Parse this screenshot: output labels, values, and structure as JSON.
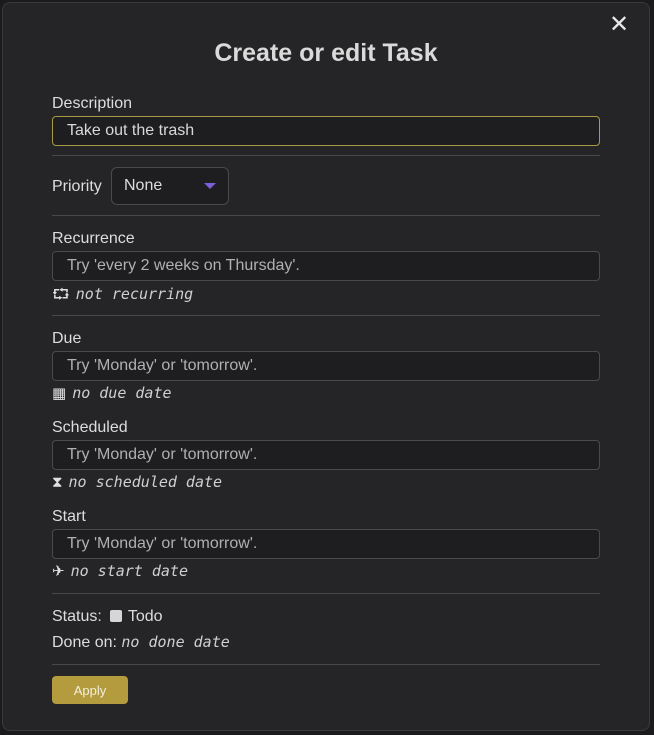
{
  "dialog": {
    "title": "Create or edit Task",
    "close_glyph": "✕"
  },
  "description": {
    "label": "Description",
    "value": "Take out the trash"
  },
  "priority": {
    "label": "Priority",
    "selected": "None"
  },
  "recurrence": {
    "label": "Recurrence",
    "placeholder": "Try 'every 2 weeks on Thursday'.",
    "icon": "recurrence-icon",
    "icon_glyph": "⮔",
    "hint": "not recurring"
  },
  "due": {
    "label": "Due",
    "placeholder": "Try 'Monday' or 'tomorrow'.",
    "icon": "calendar-icon",
    "icon_glyph": "▦",
    "hint": "no due date"
  },
  "scheduled": {
    "label": "Scheduled",
    "placeholder": "Try 'Monday' or 'tomorrow'.",
    "icon": "hourglass-icon",
    "icon_glyph": "⧗",
    "hint": "no scheduled date"
  },
  "start": {
    "label": "Start",
    "placeholder": "Try 'Monday' or 'tomorrow'.",
    "icon": "plane-departure-icon",
    "icon_glyph": "✈",
    "hint": "no start date"
  },
  "status": {
    "label": "Status:",
    "value": "Todo",
    "done_label": "Done on:",
    "done_value": "no done date"
  },
  "actions": {
    "apply_label": "Apply"
  },
  "colors": {
    "accent": "#b49b3d",
    "caret": "#7b5fd6",
    "background": "#252528"
  }
}
